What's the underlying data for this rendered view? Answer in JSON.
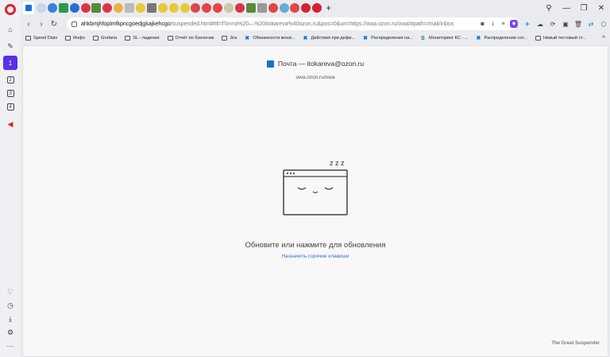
{
  "tabs": {
    "count_visible": 27,
    "new_tab_label": "+"
  },
  "window_controls": {
    "search": "⚲",
    "minimize": "—",
    "maximize": "❐",
    "close": "✕"
  },
  "nav": {
    "back": "‹",
    "forward": "›",
    "reload": "↻"
  },
  "address": {
    "host": "ahkbmjhfoplmfkpncgoedjgkajkehcgo",
    "path": "/suspended.html#ttl=Почта%20—%20itokareva%40ozon.ru&pos=0&uri=https://owa.ozon.ru/owa/#path=/mail/inbox"
  },
  "address_icons": [
    "camera-icon",
    "download-icon",
    "menu-icon",
    "account-icon"
  ],
  "bookmarks": [
    {
      "label": "Speed Dials",
      "icon": "folder-icon"
    },
    {
      "label": "Инфо",
      "icon": "folder-icon"
    },
    {
      "label": "Grafana",
      "icon": "folder-icon"
    },
    {
      "label": "SL - падения",
      "icon": "folder-icon"
    },
    {
      "label": "Отчёт по бэклогам",
      "icon": "folder-icon"
    },
    {
      "label": "Jira",
      "icon": "folder-icon"
    },
    {
      "label": "Обязанности мони...",
      "icon": "x-icon"
    },
    {
      "label": "Действия при дефи...",
      "icon": "x-icon"
    },
    {
      "label": "Распределение на...",
      "icon": "x-icon"
    },
    {
      "label": "Мониторинг КС - ...",
      "icon": "sharepoint-icon"
    },
    {
      "label": "Распределение сот...",
      "icon": "x-icon"
    },
    {
      "label": "Новый тестовый ст...",
      "icon": "page-icon"
    }
  ],
  "bookmarks_more": "»",
  "page": {
    "title": "Почта — itokareva@ozon.ru",
    "url": "owa.ozon.ru/owa",
    "zzz": "z z z",
    "message": "Обновите или нажмите для обновления",
    "hotkeys_link": "Назначить горячие клавиши",
    "brand": "The Great Suspender"
  },
  "sidebar": {
    "items": [
      "home",
      "pinboard",
      "workspace-1",
      "workspace-2",
      "workspace-3",
      "workspace-4",
      "player"
    ],
    "workspace_labels": [
      "1",
      "2",
      "3",
      "4"
    ],
    "bottom": [
      "heart-icon",
      "history-icon",
      "download-icon",
      "settings-icon",
      "more-icon"
    ]
  },
  "colors": {
    "accent": "#5b2ee8",
    "opera_red": "#e0202e",
    "link": "#3d6fcf"
  }
}
